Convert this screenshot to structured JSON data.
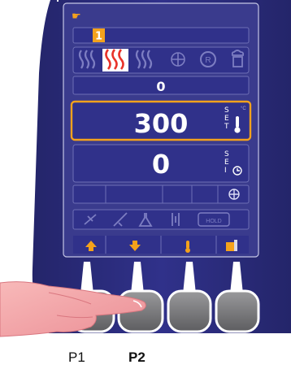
{
  "display": {
    "setpoint_index": "1",
    "counter_value": "0",
    "temperature_set": "300",
    "timer_set": "0",
    "set_label_top": "SET",
    "set_label_bottom": "SEI",
    "unit": "°C",
    "hold_label": "HOLD"
  },
  "modes": {
    "row1_icons": [
      "steam-low-icon",
      "steam-high-icon",
      "steam-off-icon",
      "fan-icon",
      "rotation-icon",
      "chef-icon"
    ],
    "active_index": 1,
    "row2_icons": [
      "probe-icon",
      "knife-icon",
      "flask-icon",
      "core-icon",
      "hold-icon"
    ]
  },
  "buttons": [
    {
      "id": "P1",
      "label": "P1",
      "function": "up-arrow-icon",
      "pressed": false
    },
    {
      "id": "P2",
      "label": "P2",
      "function": "down-arrow-icon",
      "pressed": true
    },
    {
      "id": "P3",
      "label": "",
      "function": "thermometer-icon",
      "pressed": false
    },
    {
      "id": "P4",
      "label": "",
      "function": "door-icon",
      "pressed": false
    }
  ],
  "colors": {
    "panel": "#2e2f7a",
    "screen": "#3b3c90",
    "screen_border": "#6e6fb5",
    "highlight": "#f4a21c",
    "active_icon_red": "#e8332a",
    "arrow_orange": "#f5a21b",
    "button_gray": "#7a7a7c"
  }
}
